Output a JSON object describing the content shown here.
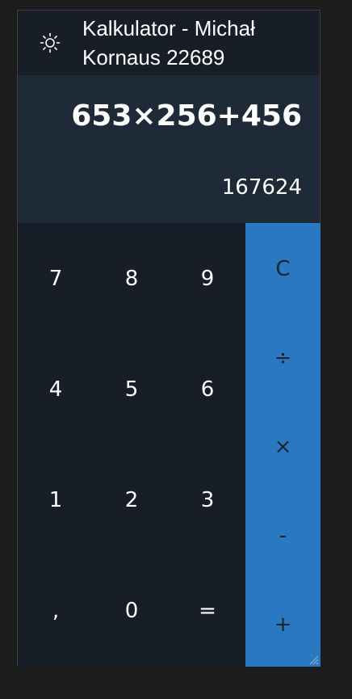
{
  "window": {
    "title": "Kalkulator - Michał Kornaus 22689",
    "theme_icon": "sun-icon"
  },
  "display": {
    "expression": "653×256+456",
    "result": "167624"
  },
  "keypad": {
    "keys": [
      "7",
      "8",
      "9",
      "4",
      "5",
      "6",
      "1",
      "2",
      "3",
      ",",
      "0",
      "="
    ]
  },
  "operators": {
    "keys": [
      "C",
      "÷",
      "×",
      "-",
      "+"
    ]
  },
  "colors": {
    "window_bg": "#171e27",
    "display_bg": "#1e2a37",
    "operator_bg": "#2a78c1",
    "page_bg": "#1c1c1c"
  }
}
